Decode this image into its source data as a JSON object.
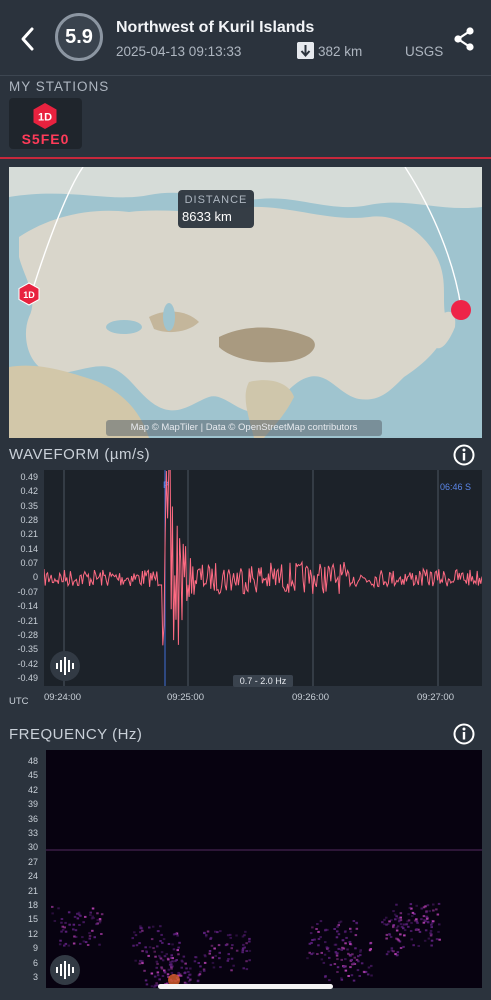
{
  "event": {
    "magnitude": "5.9",
    "title": "Northwest of Kuril Islands",
    "datetime": "2025-04-13 09:13:33",
    "depth": "382 km",
    "source": "USGS"
  },
  "stations": {
    "heading": "MY STATIONS",
    "items": [
      {
        "network": "1D",
        "code": "S5FE0"
      }
    ]
  },
  "map": {
    "distance_label": "DISTANCE",
    "distance_value": "8633 km",
    "attribution": "Map © MapTiler | Data © OpenStreetMap contributors",
    "station_marker": "1D"
  },
  "waveform": {
    "heading": "WAVEFORM (µm/s)",
    "y_ticks": [
      "0.49",
      "0.42",
      "0.35",
      "0.28",
      "0.21",
      "0.14",
      "0.07",
      "0",
      "-0.07",
      "-0.14",
      "-0.21",
      "-0.28",
      "-0.35",
      "-0.42",
      "-0.49"
    ],
    "x_ticks": [
      "09:24:00",
      "09:25:00",
      "09:26:00",
      "09:27:00"
    ],
    "utc_label": "UTC",
    "filter_label": "0.7 - 2.0 Hz",
    "corner_label": "06:46  S",
    "p_label": "P"
  },
  "frequency": {
    "heading": "FREQUENCY (Hz)",
    "y_ticks": [
      "48",
      "45",
      "42",
      "39",
      "36",
      "33",
      "30",
      "27",
      "24",
      "21",
      "18",
      "15",
      "12",
      "9",
      "6",
      "3"
    ]
  },
  "colors": {
    "accent_red": "#ff3b59",
    "wave": "#ff6b83",
    "background": "#2b333d"
  }
}
